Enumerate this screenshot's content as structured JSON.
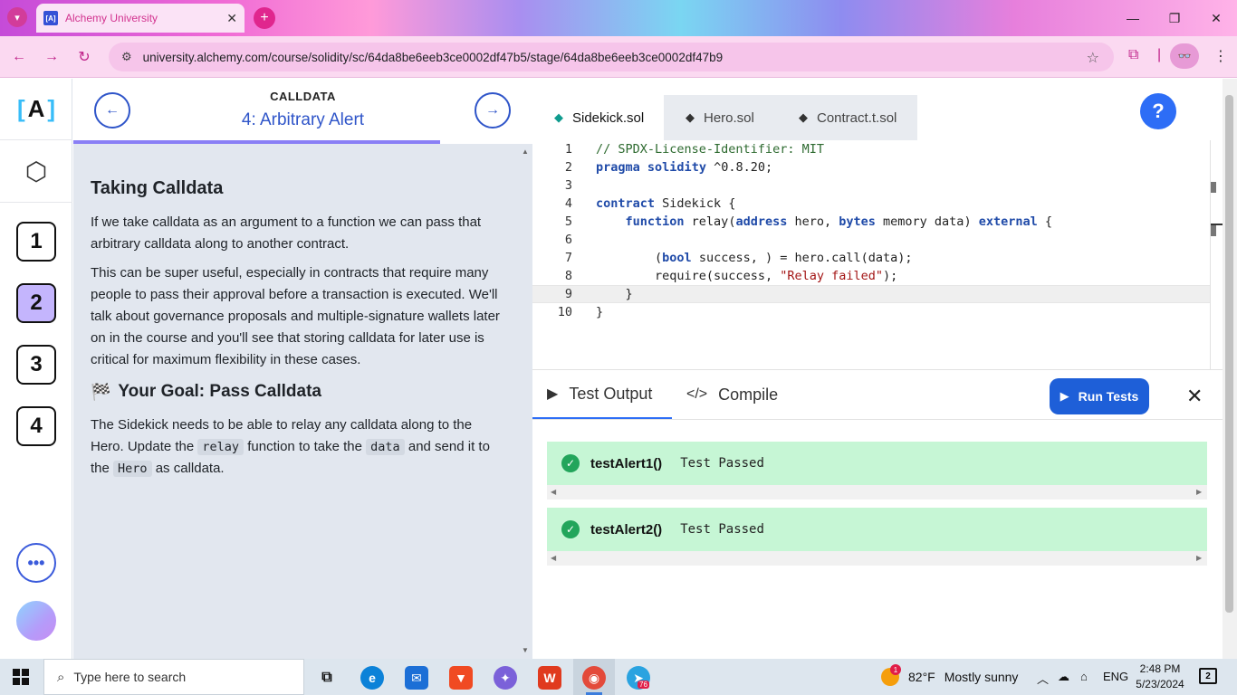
{
  "browser": {
    "tab_title": "Alchemy University",
    "tab_favicon": "[A]",
    "url": "university.alchemy.com/course/solidity/sc/64da8be6eeb3ce0002df47b5/stage/64da8be6eeb3ce0002df47b9",
    "icons": [
      "tab-search-icon",
      "close-icon",
      "plus-icon",
      "back-arrow-icon",
      "forward-arrow-icon",
      "reload-icon",
      "site-settings-icon",
      "bookmark-star-icon",
      "extensions-icon",
      "profile-icon",
      "kebab-menu-icon",
      "minimize-icon",
      "maximize-icon",
      "window-close-icon"
    ]
  },
  "rail": {
    "logo_text": "A",
    "stages": [
      "1",
      "2",
      "3",
      "4"
    ],
    "active_stage": "2",
    "more_icon": "•••"
  },
  "lesson": {
    "section": "CALLDATA",
    "title": "4: Arbitrary Alert",
    "heading": "Taking Calldata",
    "para1": "If we take calldata as an argument to a function we can pass that arbitrary calldata along to another contract.",
    "para2": "This can be super useful, especially in contracts that require many people to pass their approval before a transaction is executed. We'll talk about governance proposals and multiple-signature wallets later on in the course and you'll see that storing calldata for later use is critical for maximum flexibility in these cases.",
    "goal_heading": "Your Goal: Pass Calldata",
    "goal_p1": "The Sidekick needs to be able to relay any calldata along to the Hero. Update the",
    "goal_code1": "relay",
    "goal_p2": "function to take the",
    "goal_code2": "data",
    "goal_p3": "and send it to the",
    "goal_code3": "Hero",
    "goal_p4": "as calldata."
  },
  "editor": {
    "tabs": [
      "Sidekick.sol",
      "Hero.sol",
      "Contract.t.sol"
    ],
    "active_tab": "Sidekick.sol",
    "help_label": "?",
    "line_numbers": [
      "1",
      "2",
      "3",
      "4",
      "5",
      "6",
      "7",
      "8",
      "9",
      "10"
    ],
    "code": {
      "l1": "// SPDX-License-Identifier: MIT",
      "l2_kw1": "pragma",
      "l2_kw2": "solidity",
      "l2_rest": " ^0.8.20;",
      "l4_kw": "contract",
      "l4_rest": " Sidekick {",
      "l5_kw1": "function",
      "l5_a": " relay(",
      "l5_kw2": "address",
      "l5_b": " hero, ",
      "l5_kw3": "bytes",
      "l5_c": " memory data) ",
      "l5_kw4": "external",
      "l5_d": " {",
      "l7_a": "(",
      "l7_kw": "bool",
      "l7_b": " success, ) = hero.call(data);",
      "l8_a": "require(success, ",
      "l8_str": "\"Relay failed\"",
      "l8_b": ");",
      "l9": "}",
      "l10": "}"
    }
  },
  "output": {
    "tab_test_output": "Test Output",
    "tab_compile": "Compile",
    "run_button": "Run Tests",
    "results": [
      {
        "name": "testAlert1()",
        "status": "Test Passed"
      },
      {
        "name": "testAlert2()",
        "status": "Test Passed"
      }
    ]
  },
  "taskbar": {
    "search_placeholder": "Type here to search",
    "weather_temp": "82°F",
    "weather_desc": "Mostly sunny",
    "weather_badge": "1",
    "language": "ENG",
    "time": "2:48 PM",
    "date": "5/23/2024",
    "telegram_badge": "76",
    "notification_count": "2"
  },
  "colors": {
    "accent": "#2f55c9",
    "run_button": "#1e5fd8",
    "pass_bg": "#c6f6d5",
    "pass_check": "#22a55b",
    "active_stage": "#c4b5fd"
  }
}
